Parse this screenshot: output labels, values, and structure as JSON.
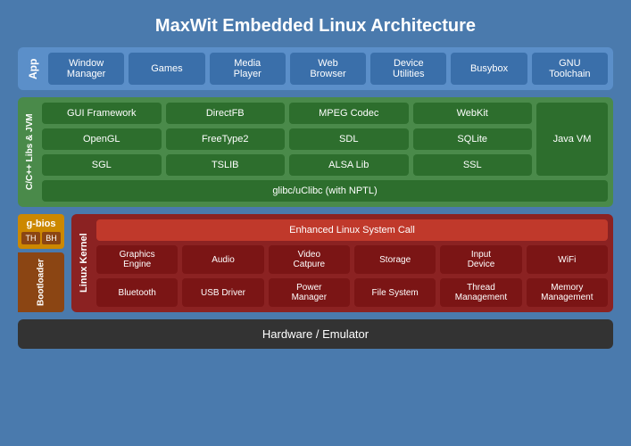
{
  "title": "MaxWit Embedded Linux Architecture",
  "app_layer": {
    "label": "App",
    "boxes": [
      {
        "id": "window-manager",
        "text": "Window Manager"
      },
      {
        "id": "games",
        "text": "Games"
      },
      {
        "id": "media-player",
        "text": "Media Player"
      },
      {
        "id": "web-browser",
        "text": "Web Browser"
      },
      {
        "id": "device-utilities",
        "text": "Device Utilities"
      },
      {
        "id": "busybox",
        "text": "Busybox"
      },
      {
        "id": "gnu-toolchain",
        "text": "GNU Toolchain"
      }
    ]
  },
  "libs_layer": {
    "label": "C/C++ Libs & JVM",
    "row1": [
      {
        "id": "gui-framework",
        "text": "GUI Framework"
      },
      {
        "id": "directfb",
        "text": "DirectFB"
      },
      {
        "id": "mpeg-codec",
        "text": "MPEG Codec"
      },
      {
        "id": "webkit",
        "text": "WebKit"
      }
    ],
    "row2": [
      {
        "id": "opengl",
        "text": "OpenGL"
      },
      {
        "id": "freetype2",
        "text": "FreeType2"
      },
      {
        "id": "sdl",
        "text": "SDL"
      },
      {
        "id": "sqlite",
        "text": "SQLite"
      }
    ],
    "row3": [
      {
        "id": "sgl",
        "text": "SGL"
      },
      {
        "id": "tslib",
        "text": "TSLIB"
      },
      {
        "id": "alsa-lib",
        "text": "ALSA Lib"
      },
      {
        "id": "ssl",
        "text": "SSL"
      }
    ],
    "javavm": "Java VM",
    "glibc": "glibc/uClibc (with NPTL)"
  },
  "kernel_layer": {
    "label": "Linux Kernel",
    "syscall": "Enhanced Linux System Call",
    "row1": [
      {
        "id": "graphics-engine",
        "text": "Graphics Engine"
      },
      {
        "id": "audio",
        "text": "Audio"
      },
      {
        "id": "video-capture",
        "text": "Video Catpure"
      },
      {
        "id": "storage",
        "text": "Storage"
      },
      {
        "id": "input-device",
        "text": "Input Device"
      },
      {
        "id": "wifi",
        "text": "WiFi"
      }
    ],
    "row2": [
      {
        "id": "bluetooth",
        "text": "Bluetooth"
      },
      {
        "id": "usb-driver",
        "text": "USB Driver"
      },
      {
        "id": "power-manager",
        "text": "Power Manager"
      },
      {
        "id": "file-system",
        "text": "File System"
      },
      {
        "id": "thread-management",
        "text": "Thread Management"
      },
      {
        "id": "memory-management",
        "text": "Memory Management"
      }
    ]
  },
  "bootloader": {
    "label": "Bootloader",
    "gbios": "g-bios",
    "th": "TH",
    "bh": "BH"
  },
  "hardware": {
    "label": "Hardware / Emulator"
  }
}
